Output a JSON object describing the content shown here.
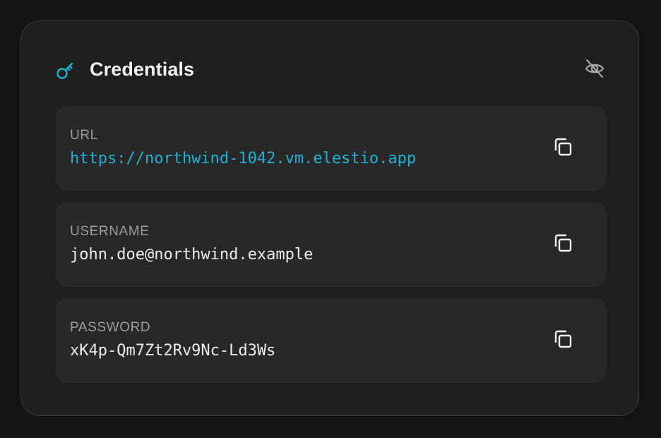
{
  "card": {
    "title": "Credentials",
    "icon": "key-icon",
    "toggle_icon": "eye-off-icon"
  },
  "rows": [
    {
      "label": "URL",
      "value": "https://northwind-1042.vm.elestio.app",
      "is_link": true,
      "action_icon": "copy-icon"
    },
    {
      "label": "USERNAME",
      "value": "john.doe@northwind.example",
      "is_link": false,
      "action_icon": "copy-icon"
    },
    {
      "label": "PASSWORD",
      "value": "xK4p-Qm7Zt2Rv9Nc-Ld3Ws",
      "is_link": false,
      "action_icon": "copy-icon"
    }
  ],
  "colors": {
    "background": "#141414",
    "card": "#1f1f1f",
    "row": "#282828",
    "accent": "#1fb0d4",
    "label": "#9c9c9c",
    "text": "#ededed"
  }
}
